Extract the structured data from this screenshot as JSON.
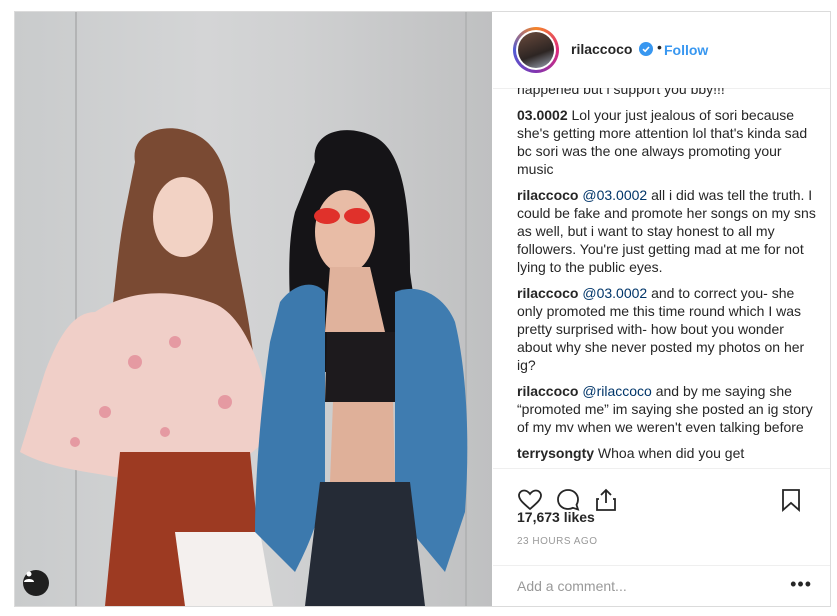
{
  "post": {
    "username": "rilaccoco",
    "follow_label": "Follow",
    "dot": "•",
    "likes": "17,673 likes",
    "timestamp": "23 HOURS AGO",
    "add_comment_placeholder": "Add a comment...",
    "more": "•••"
  },
  "comments": [
    {
      "user": "",
      "mention": "",
      "text": "happened but i support you bby!!!"
    },
    {
      "user": "03.0002",
      "mention": "",
      "text": "Lol your just jealous of sori because she's getting more attention lol that's kinda sad bc sori was the one always promoting your music"
    },
    {
      "user": "rilaccoco",
      "mention": "@03.0002",
      "text": "all i did was tell the truth. I could be fake and promote her songs on my sns as well, but i want to stay honest to all my followers. You're just getting mad at me for not lying to the public eyes."
    },
    {
      "user": "rilaccoco",
      "mention": "@03.0002",
      "text": "and to correct you- she only promoted me this time round which I was pretty surprised with- how bout you wonder about why she never posted my photos on her ig?"
    },
    {
      "user": "rilaccoco",
      "mention": "@rilaccoco",
      "text": "and by me saying she “promoted me” im saying she posted an ig story of my mv when we weren't even talking before"
    },
    {
      "user": "terrysongty",
      "mention": "",
      "text": "Whoa when did you get"
    }
  ],
  "colors": {
    "accent": "#3897f0",
    "text": "#262626",
    "muted": "#999999",
    "border": "#efefef"
  },
  "icons": [
    "verified-badge-icon",
    "heart-icon",
    "comment-icon",
    "share-icon",
    "bookmark-icon",
    "user-tag-icon",
    "more-options-icon"
  ]
}
